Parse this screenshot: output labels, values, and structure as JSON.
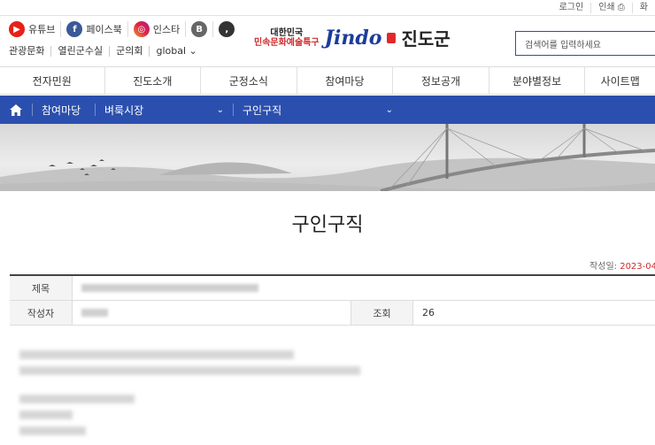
{
  "util": {
    "login": "로그인",
    "print": "인쇄",
    "zoom": "화"
  },
  "sns": {
    "youtube": "유튜브",
    "facebook": "페이스북",
    "instagram": "인스타",
    "blog_letter": "B",
    "kakao_letter": ","
  },
  "quick": [
    "관광문화",
    "열린군수실",
    "군의회",
    "global"
  ],
  "logo": {
    "tag_line1": "대한민국",
    "tag_line2": "민속문화예술특구",
    "brand": "Jindo",
    "name": "진도군"
  },
  "search": {
    "placeholder": "검색어를 입력하세요"
  },
  "gnb": [
    "전자민원",
    "진도소개",
    "군정소식",
    "참여마당",
    "정보공개",
    "분야별정보",
    "사이트맵"
  ],
  "breadcrumb": {
    "c1": "참여마당",
    "c2": "벼룩시장",
    "c3": "구인구직"
  },
  "page": {
    "title": "구인구직",
    "date_label": "작성일: ",
    "date_value": "2023-04"
  },
  "table": {
    "subject_label": "제목",
    "author_label": "작성자",
    "views_label": "조회",
    "views": "26"
  },
  "colors": {
    "primary": "#2b4fae",
    "accent": "#d12c2c"
  }
}
